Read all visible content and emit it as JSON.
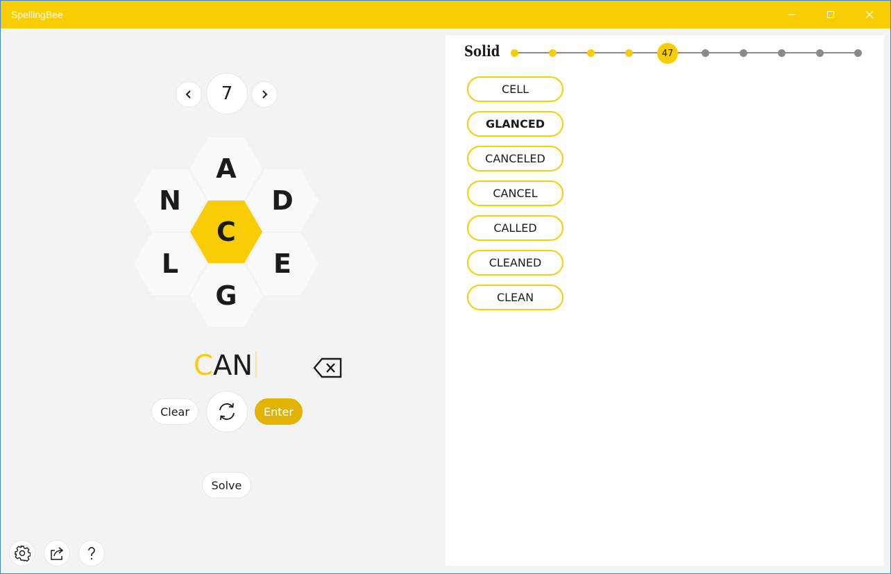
{
  "window": {
    "title": "SpellingBee"
  },
  "puzzle": {
    "number": "7"
  },
  "hive": {
    "top": "A",
    "upper_left": "N",
    "upper_right": "D",
    "center": "C",
    "lower_left": "L",
    "lower_right": "E",
    "bottom": "G"
  },
  "entry": {
    "center_part": "C",
    "rest": "AN"
  },
  "controls": {
    "clear_label": "Clear",
    "enter_label": "Enter",
    "solve_label": "Solve"
  },
  "progress": {
    "rank": "Solid",
    "score": "47"
  },
  "found_words": [
    "CELL",
    "GLANCED",
    "CANCELED",
    "CANCEL",
    "CALLED",
    "CLEANED",
    "CLEAN"
  ],
  "colors": {
    "accent": "#f8cd05",
    "enter": "#e2b400",
    "inactive": "#8a8a8a"
  }
}
